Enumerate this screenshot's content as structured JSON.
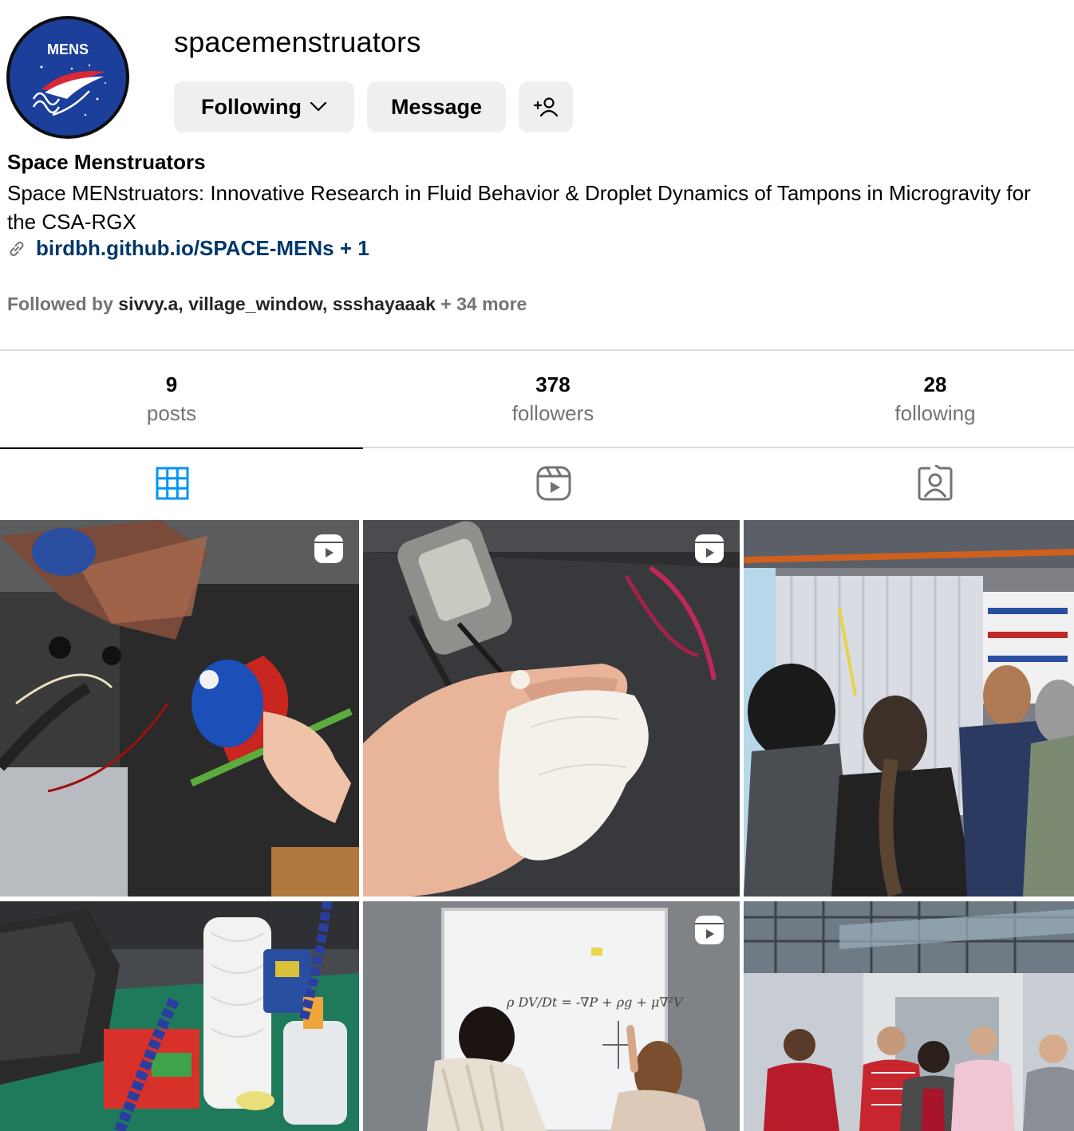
{
  "profile": {
    "username": "spacemenstruators",
    "avatar_text": "MENS",
    "display_name": "Space Menstruators",
    "bio": "Space MENstruators: Innovative Research in Fluid Behavior & Droplet Dynamics of Tampons in Microgravity for the CSA-RGX",
    "link_text": "birdbh.github.io/SPACE-MENs + 1",
    "followed_by_prefix": "Followed by ",
    "followed_by_names": "sivvy.a, village_window, ssshayaaak",
    "followed_by_more": " + 34 more"
  },
  "actions": {
    "following_label": "Following",
    "message_label": "Message",
    "add_user_icon": "add-person-icon"
  },
  "stats": [
    {
      "value": "9",
      "label": "posts"
    },
    {
      "value": "378",
      "label": "followers"
    },
    {
      "value": "28",
      "label": "following"
    }
  ],
  "tabs": [
    {
      "name": "posts",
      "icon": "grid-icon",
      "active": true
    },
    {
      "name": "reels",
      "icon": "reels-icon",
      "active": false
    },
    {
      "name": "tagged",
      "icon": "tagged-icon",
      "active": false
    }
  ],
  "posts": [
    {
      "scene": "soldering-red-cup",
      "is_reel": true
    },
    {
      "scene": "hand-holding-tampon-cotton",
      "is_reel": true
    },
    {
      "scene": "plastic-sheet-store-group",
      "is_reel": false
    },
    {
      "scene": "workbench-paper-towel",
      "is_reel": false
    },
    {
      "scene": "whiteboard-equation",
      "is_reel": true
    },
    {
      "scene": "group-photo-outside-building",
      "is_reel": false
    }
  ],
  "colors": {
    "link": "#00376b",
    "button_bg": "#efefef",
    "secondary_text": "#737373",
    "active_tab_icon": "#0095f6",
    "divider": "#dbdbdb"
  }
}
